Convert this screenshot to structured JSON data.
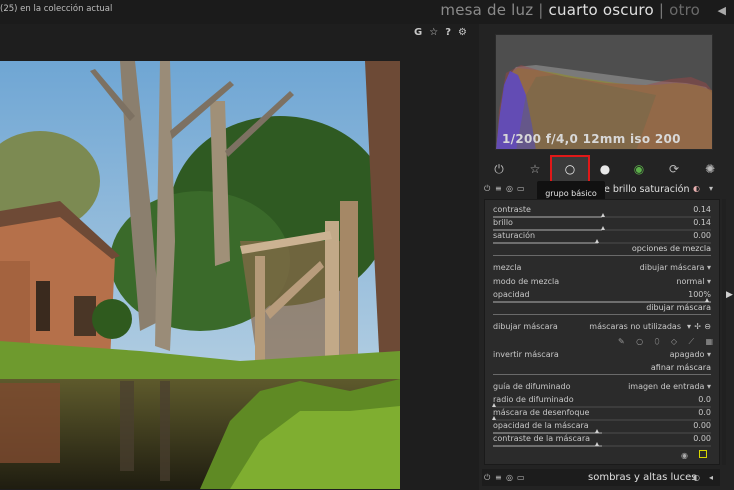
{
  "topbar": {
    "collection_info": "(25) en la colección actual",
    "views": [
      "mesa de luz",
      "cuarto oscuro",
      "otro"
    ],
    "separator": "|"
  },
  "toolbar": {
    "icons": [
      "G",
      "☆",
      "?",
      "⚙"
    ]
  },
  "histogram": {
    "caption": "1/200 f/4,0 12mm iso 200"
  },
  "group_tabs": {
    "tooltip": "grupo básico",
    "icons": [
      "power-icon",
      "star-icon",
      "circle-icon",
      "sphere-icon",
      "color-icon",
      "correct-icon",
      "effect-icon"
    ]
  },
  "module": {
    "title": "contraste brillo saturación",
    "title_visible": "e brillo saturación",
    "sliders": [
      {
        "label": "contraste",
        "value": "0.14",
        "level": 0.5
      },
      {
        "label": "brillo",
        "value": "0.14",
        "level": 0.5
      },
      {
        "label": "saturación",
        "value": "0.00",
        "level": 0.48
      }
    ],
    "blend_section": "opciones de mezcla",
    "mezcla": {
      "label": "mezcla",
      "value": "dibujar máscara"
    },
    "modo": {
      "label": "modo de mezcla",
      "value": "normal"
    },
    "opacidad": {
      "label": "opacidad",
      "value": "100%",
      "level": 1.0
    },
    "draw_section": "dibujar máscara",
    "dibujar": {
      "label": "dibujar máscara",
      "value": "máscaras no utilizadas"
    },
    "invertir": {
      "label": "invertir máscara",
      "value": "apagado"
    },
    "refine_section": "afinar máscara",
    "guia": {
      "label": "guía de difuminado",
      "value": "imagen de entrada"
    },
    "refine_sliders": [
      {
        "label": "radio de difuminado",
        "value": "0.0",
        "level": 0.0
      },
      {
        "label": "máscara de desenfoque",
        "value": "0.0",
        "level": 0.0
      },
      {
        "label": "opacidad de la máscara",
        "value": "0.00",
        "level": 0.5
      },
      {
        "label": "contraste de la máscara",
        "value": "0.00",
        "level": 0.5
      }
    ]
  },
  "footer": {
    "next_module": "sombras y altas luces"
  },
  "colors": {
    "highlight": "#e01818",
    "accent_yellow": "#d8d600"
  }
}
